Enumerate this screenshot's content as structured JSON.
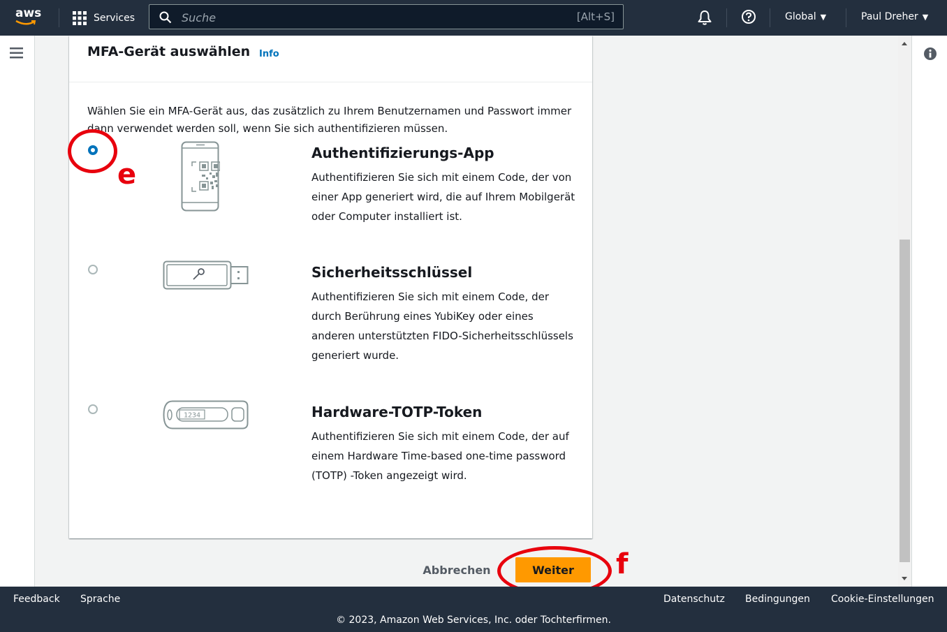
{
  "nav": {
    "logo": "aws",
    "services_label": "Services",
    "search_placeholder": "Suche",
    "search_shortcut": "[Alt+S]",
    "region_label": "Global",
    "user_label": "Paul Dreher"
  },
  "card": {
    "title": "MFA-Gerät auswählen",
    "info_link": "Info",
    "description": "Wählen Sie ein MFA-Gerät aus, das zusätzlich zu Ihrem Benutzernamen und Passwort immer dann verwendet werden soll, wenn Sie sich authentifizieren müssen.",
    "options": [
      {
        "title": "Authentifizierungs-App",
        "description": "Authentifizieren Sie sich mit einem Code, der von einer App generiert wird, die auf Ihrem Mobilgerät oder Computer installiert ist.",
        "selected": true
      },
      {
        "title": "Sicherheitsschlüssel",
        "description": "Authentifizieren Sie sich mit einem Code, der durch Berührung eines YubiKey oder eines anderen unterstützten FIDO-Sicherheitsschlüssels generiert wurde.",
        "selected": false
      },
      {
        "title": "Hardware-TOTP-Token",
        "description": "Authentifizieren Sie sich mit einem Code, der auf einem Hardware Time-based one-time password (TOTP) -Token angezeigt wird.",
        "selected": false
      }
    ],
    "token_display": "1234"
  },
  "actions": {
    "cancel_label": "Abbrechen",
    "next_label": "Weiter"
  },
  "annotations": {
    "e_label": "e",
    "f_label": "f",
    "color": "#e8000d"
  },
  "footer": {
    "feedback": "Feedback",
    "language": "Sprache",
    "privacy": "Datenschutz",
    "terms": "Bedingungen",
    "cookies": "Cookie-Einstellungen",
    "copyright": "© 2023, Amazon Web Services, Inc. oder Tochterfirmen."
  },
  "colors": {
    "nav_bg": "#232f3e",
    "primary_button": "#ff9900",
    "link": "#0073bb",
    "radio_selected": "#0073bb"
  }
}
